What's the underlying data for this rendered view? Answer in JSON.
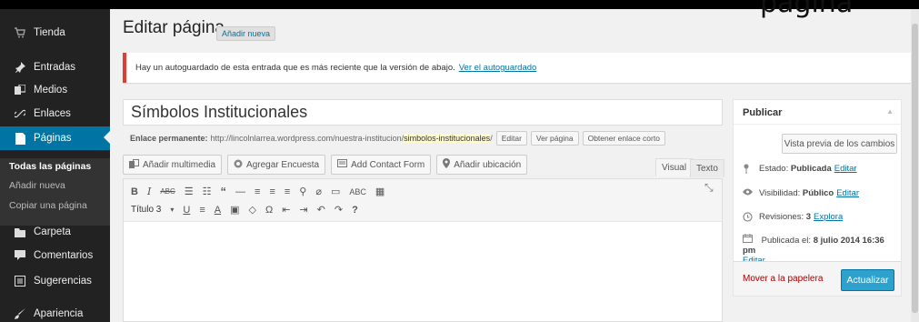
{
  "corner_title": "pagina",
  "sidebar": {
    "items": [
      {
        "label": "Tienda",
        "icon": "cart-icon"
      },
      {
        "label": "Entradas",
        "icon": "pin-icon"
      },
      {
        "label": "Medios",
        "icon": "media-icon"
      },
      {
        "label": "Enlaces",
        "icon": "link-icon"
      },
      {
        "label": "Páginas",
        "icon": "page-icon"
      },
      {
        "label": "Carpeta",
        "icon": "folder-icon"
      },
      {
        "label": "Comentarios",
        "icon": "comment-icon"
      },
      {
        "label": "Sugerencias",
        "icon": "feedback-icon"
      },
      {
        "label": "Apariencia",
        "icon": "brush-icon"
      }
    ],
    "submenu": [
      "Todas las páginas",
      "Añadir nueva",
      "Copiar una página"
    ]
  },
  "header": {
    "title": "Editar página",
    "add_new": "Añadir nueva"
  },
  "notice": {
    "text": "Hay un autoguardado de esta entrada que es más reciente que la versión de abajo.",
    "link": "Ver el autoguardado"
  },
  "editor": {
    "title_value": "Símbolos Institucionales",
    "permalink_label": "Enlace permanente:",
    "permalink_base": "http://lincolnlarrea.wordpress.com/nuestra-institucion/",
    "permalink_slug": "simbolos-institucionales",
    "permalink_end": "/",
    "edit_btn": "Editar",
    "view_btn": "Ver página",
    "shortlink_btn": "Obtener enlace corto",
    "media_buttons": [
      "Añadir multimedia",
      "Agregar Encuesta",
      "Add Contact Form",
      "Añadir ubicación"
    ],
    "tab_visual": "Visual",
    "tab_text": "Texto",
    "format_select": "Título 3"
  },
  "publish": {
    "heading": "Publicar",
    "preview": "Vista previa de los cambios",
    "status_label": "Estado:",
    "status_value": "Publicada",
    "visibility_label": "Visibilidad:",
    "visibility_value": "Público",
    "revisions_label": "Revisiones:",
    "revisions_value": "3",
    "revisions_link": "Explora",
    "published_label": "Publicada el:",
    "published_value": "8 julio 2014 16:36 pm",
    "edit": "Editar",
    "trash": "Mover a la papelera",
    "update": "Actualizar"
  },
  "colors": {
    "sidebar": "#222222",
    "active": "#0074a2",
    "primary": "#2ea2cc",
    "notice": "#dd3d36"
  }
}
